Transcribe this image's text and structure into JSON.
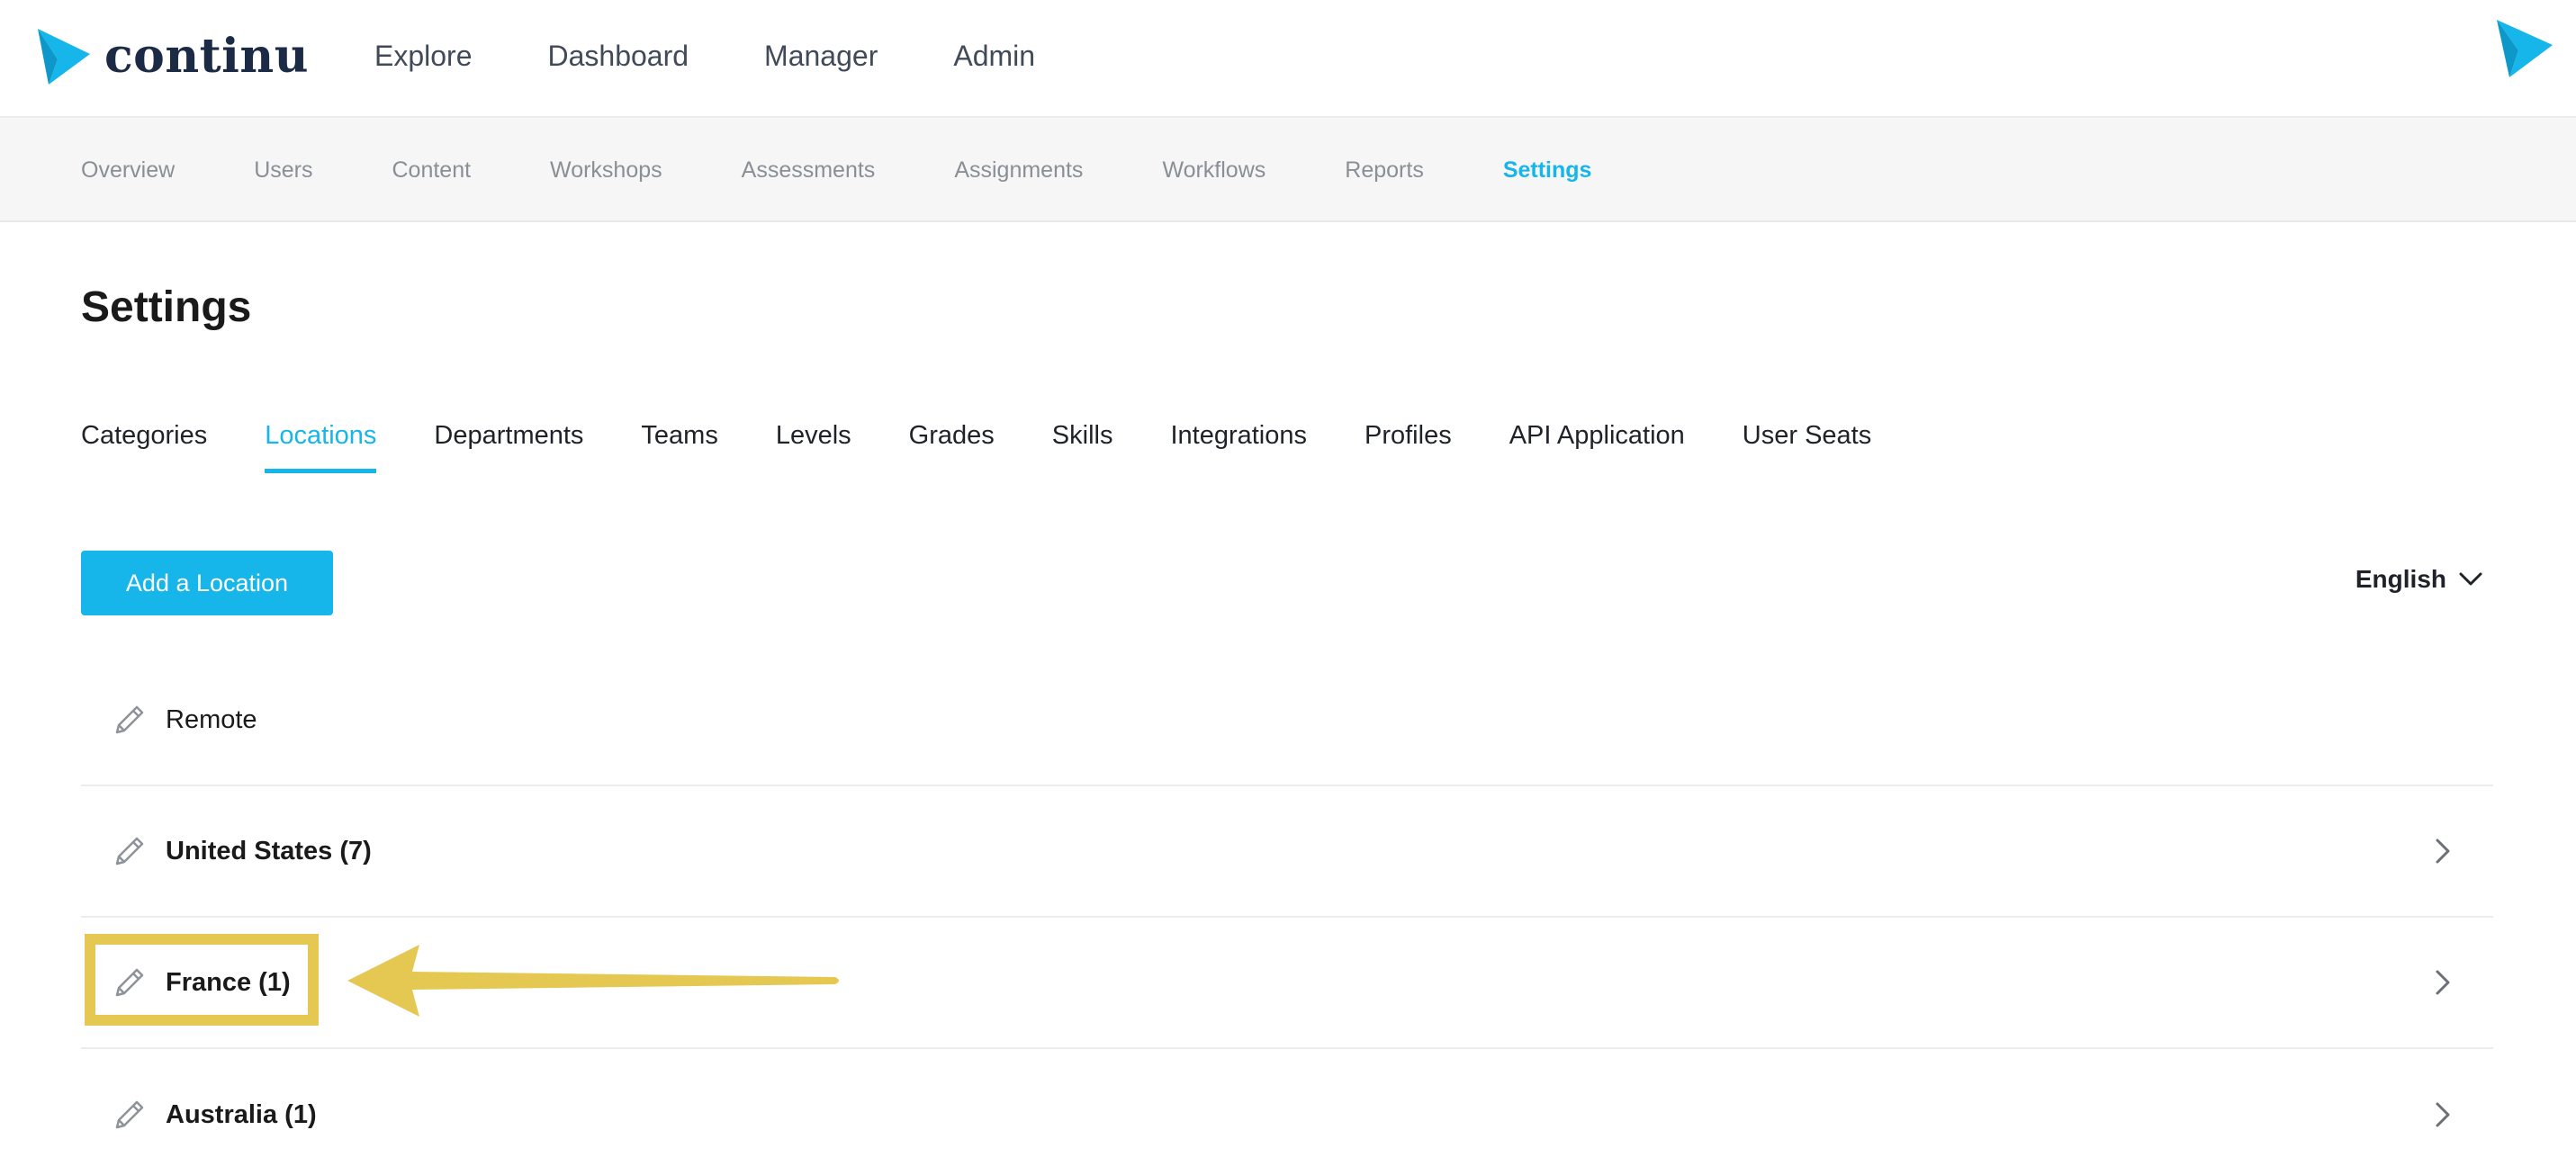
{
  "brand": {
    "name": "continu",
    "accent": "#16b6ea",
    "navy": "#1b2b45"
  },
  "top_nav": [
    "Explore",
    "Dashboard",
    "Manager",
    "Admin"
  ],
  "sub_nav": {
    "items": [
      "Overview",
      "Users",
      "Content",
      "Workshops",
      "Assessments",
      "Assignments",
      "Workflows",
      "Reports",
      "Settings"
    ],
    "active": "Settings"
  },
  "page": {
    "title": "Settings"
  },
  "tabs": {
    "items": [
      "Categories",
      "Locations",
      "Departments",
      "Teams",
      "Levels",
      "Grades",
      "Skills",
      "Integrations",
      "Profiles",
      "API Application",
      "User Seats"
    ],
    "active": "Locations"
  },
  "actions": {
    "add_label": "Add a Location",
    "language": "English"
  },
  "locations": [
    {
      "name": "Remote",
      "has_children": false
    },
    {
      "name": "United States (7)",
      "has_children": true
    },
    {
      "name": "France (1)",
      "has_children": true,
      "highlighted": true
    },
    {
      "name": "Australia (1)",
      "has_children": true
    }
  ],
  "annotation": {
    "highlight_color": "#e5c852"
  },
  "icons": {
    "edit": "pencil-icon",
    "chevron": "chevron-right-icon",
    "dropdown": "chevron-down-icon"
  }
}
